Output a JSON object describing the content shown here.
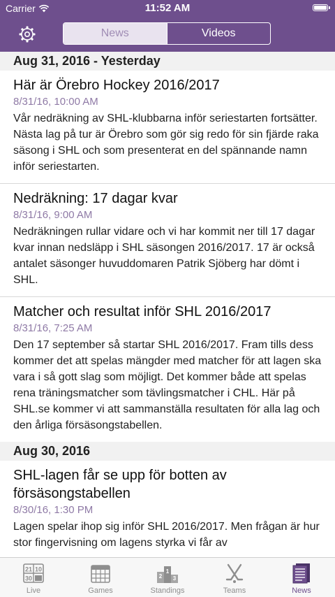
{
  "status_bar": {
    "carrier": "Carrier",
    "time": "11:52 AM",
    "battery_level": 1.0
  },
  "header": {
    "segments": [
      {
        "label": "News",
        "selected": true
      },
      {
        "label": "Videos",
        "selected": false
      }
    ],
    "settings_icon": "gear-icon",
    "colors": {
      "nav_bar": "#6e4f8d",
      "accent": "#8f7aa6"
    }
  },
  "sections": [
    {
      "title": "Aug 31, 2016 - Yesterday",
      "articles": [
        {
          "title": "Här är Örebro Hockey 2016/2017",
          "date": "8/31/16, 10:00 AM",
          "body": "Vår nedräkning av SHL-klubbarna inför seriestarten fortsätter. Nästa lag på tur är Örebro som gör sig redo för sin fjärde raka säsong i SHL och som presenterat en del spännande namn inför seriestarten."
        },
        {
          "title": "Nedräkning: 17 dagar kvar",
          "date": "8/31/16, 9:00 AM",
          "body": "Nedräkningen rullar vidare och vi har kommit ner till 17 dagar kvar innan nedsläpp i SHL säsongen 2016/2017. 17 är också antalet säsonger huvuddomaren Patrik Sjöberg har dömt i SHL."
        },
        {
          "title": "Matcher och resultat inför SHL 2016/2017",
          "date": "8/31/16, 7:25 AM",
          "body": "Den 17 september så startar SHL 2016/2017. Fram tills dess kommer det att spelas mängder med matcher för att lagen ska vara i så gott slag som möjligt. Det kommer både att spelas rena träningsmatcher som tävlingsmatcher i CHL. Här på SHL.se kommer vi att sammanställa resultaten för alla lag och den årliga försäsongstabellen."
        }
      ]
    },
    {
      "title": "Aug 30, 2016",
      "articles": [
        {
          "title": "SHL-lagen får se upp för botten av försäsongstabellen",
          "date": "8/30/16, 1:30 PM",
          "body": "Lagen spelar ihop sig inför SHL 2016/2017. Men frågan är hur stor fingervisning om lagens styrka vi får av"
        }
      ]
    }
  ],
  "tabbar": {
    "tabs": [
      {
        "label": "Live",
        "icon": "scoreboard-icon",
        "active": false
      },
      {
        "label": "Games",
        "icon": "calendar-icon",
        "active": false
      },
      {
        "label": "Standings",
        "icon": "podium-icon",
        "active": false
      },
      {
        "label": "Teams",
        "icon": "hockey-sticks-icon",
        "active": false
      },
      {
        "label": "News",
        "icon": "newspaper-icon",
        "active": true
      }
    ]
  }
}
